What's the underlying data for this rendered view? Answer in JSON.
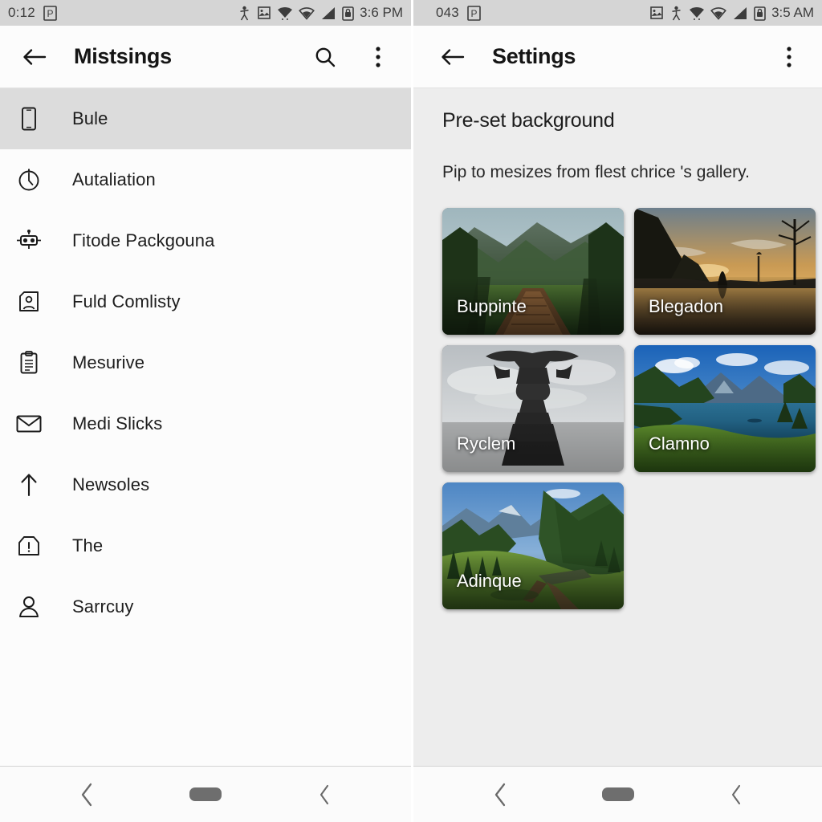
{
  "left_panel": {
    "status_bar": {
      "left_text": "0:12",
      "badge_icon": "parking-p-icon",
      "icons": [
        "person-icon",
        "image-icon",
        "wifi-alert-icon",
        "wifi-icon",
        "signal-icon",
        "battery-lock-icon"
      ],
      "time": "3:6 PM"
    },
    "app_bar": {
      "back_icon": "back-arrow-icon",
      "title": "Mistsings",
      "search_icon": "search-icon",
      "overflow_icon": "overflow-menu-icon"
    },
    "list_items": [
      {
        "label": "Bule",
        "icon": "phone-icon",
        "selected": true
      },
      {
        "label": "Autaliation",
        "icon": "clock-icon",
        "selected": false
      },
      {
        "label": "Гitode Packgouna",
        "icon": "robot-icon",
        "selected": false
      },
      {
        "label": "Fuld Comlisty",
        "icon": "contact-card-icon",
        "selected": false
      },
      {
        "label": "Mesurive",
        "icon": "clipboard-icon",
        "selected": false
      },
      {
        "label": "Medi Slicks",
        "icon": "envelope-icon",
        "selected": false
      },
      {
        "label": "Newsoles",
        "icon": "up-arrow-icon",
        "selected": false
      },
      {
        "label": "The",
        "icon": "tag-alert-icon",
        "selected": false
      },
      {
        "label": "Sarrcuy",
        "icon": "person-icon",
        "selected": false
      }
    ]
  },
  "right_panel": {
    "status_bar": {
      "left_text": "043",
      "badge_icon": "parking-p-icon",
      "icons": [
        "image-icon",
        "person-icon",
        "wifi-alert-icon",
        "wifi-icon",
        "signal-icon",
        "battery-lock-icon"
      ],
      "time": "3:5 AM"
    },
    "app_bar": {
      "back_icon": "back-arrow-icon",
      "title": "Settings",
      "overflow_icon": "overflow-menu-icon"
    },
    "section": {
      "title": "Pre-set background",
      "subtitle": "Pip to mesizes from flest chrice 's gallery."
    },
    "thumbnails": [
      {
        "label": "Buppinte",
        "scene": "green-valley-boardwalk"
      },
      {
        "label": "Blegadon",
        "scene": "sunset-lake-monolith"
      },
      {
        "label": "Ryclem",
        "scene": "stone-monument-gray-sky"
      },
      {
        "label": "Clamno",
        "scene": "blue-mountain-lake"
      },
      {
        "label": "Adinque",
        "scene": "alpine-meadow-valley"
      }
    ]
  },
  "nav_bar": {
    "back_icon": "chevron-left-icon",
    "home_icon": "home-pill-icon",
    "recents_icon": "chevron-left-icon"
  },
  "colors": {
    "status_bar_bg": "#d5d5d5",
    "app_bar_bg": "#fcfcfc",
    "selected_row_bg": "#dcdcdc",
    "content_bg": "#ededed",
    "text_primary": "#1d1d1d",
    "nav_pill": "#6e6e6e"
  }
}
